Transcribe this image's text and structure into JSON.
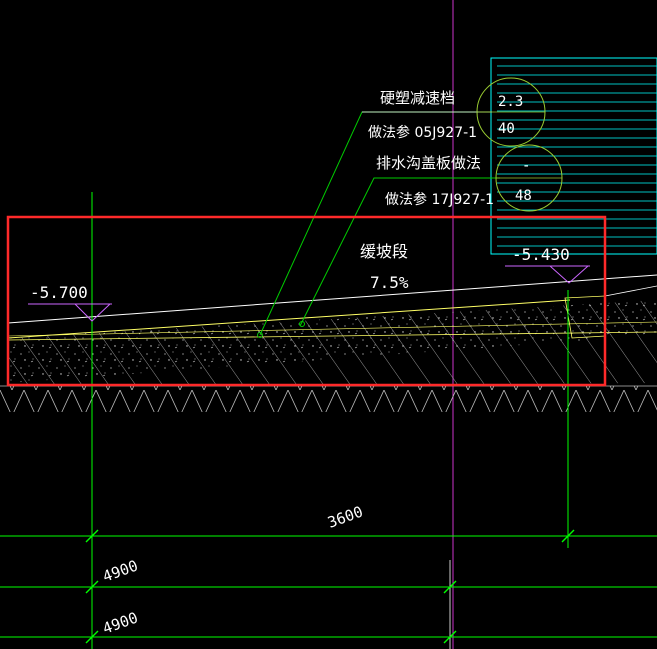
{
  "annotations": {
    "speed_bump_title": "硬塑减速档",
    "speed_bump_ref": "做法参 05J927-1",
    "drain_cover_title": "排水沟盖板做法",
    "drain_cover_ref": "做法参 17J927-1",
    "slope_title": "缓坡段",
    "slope_value": "7.5%"
  },
  "callouts": {
    "upper_top": "2.3",
    "upper_bottom": "40",
    "lower_top": "-",
    "lower_bottom": "48"
  },
  "elevations": {
    "left": "-5.700",
    "right": "-5.430"
  },
  "dimensions": {
    "span": "3600",
    "overall_1": "4900",
    "overall_2": "4900"
  },
  "colors": {
    "background": "#000000",
    "dimension_line": "#00ff00",
    "annotation": "#ffffff",
    "callout_circle": "#9acd32",
    "leader": "#00cc00",
    "axis": "#cc33cc",
    "hatch": "#cccccc",
    "cyan_block": "#00ffff",
    "highlight_box": "#ff2a2a",
    "slab_edge": "#ffff66",
    "elevation_marker": "#cc66ff"
  }
}
